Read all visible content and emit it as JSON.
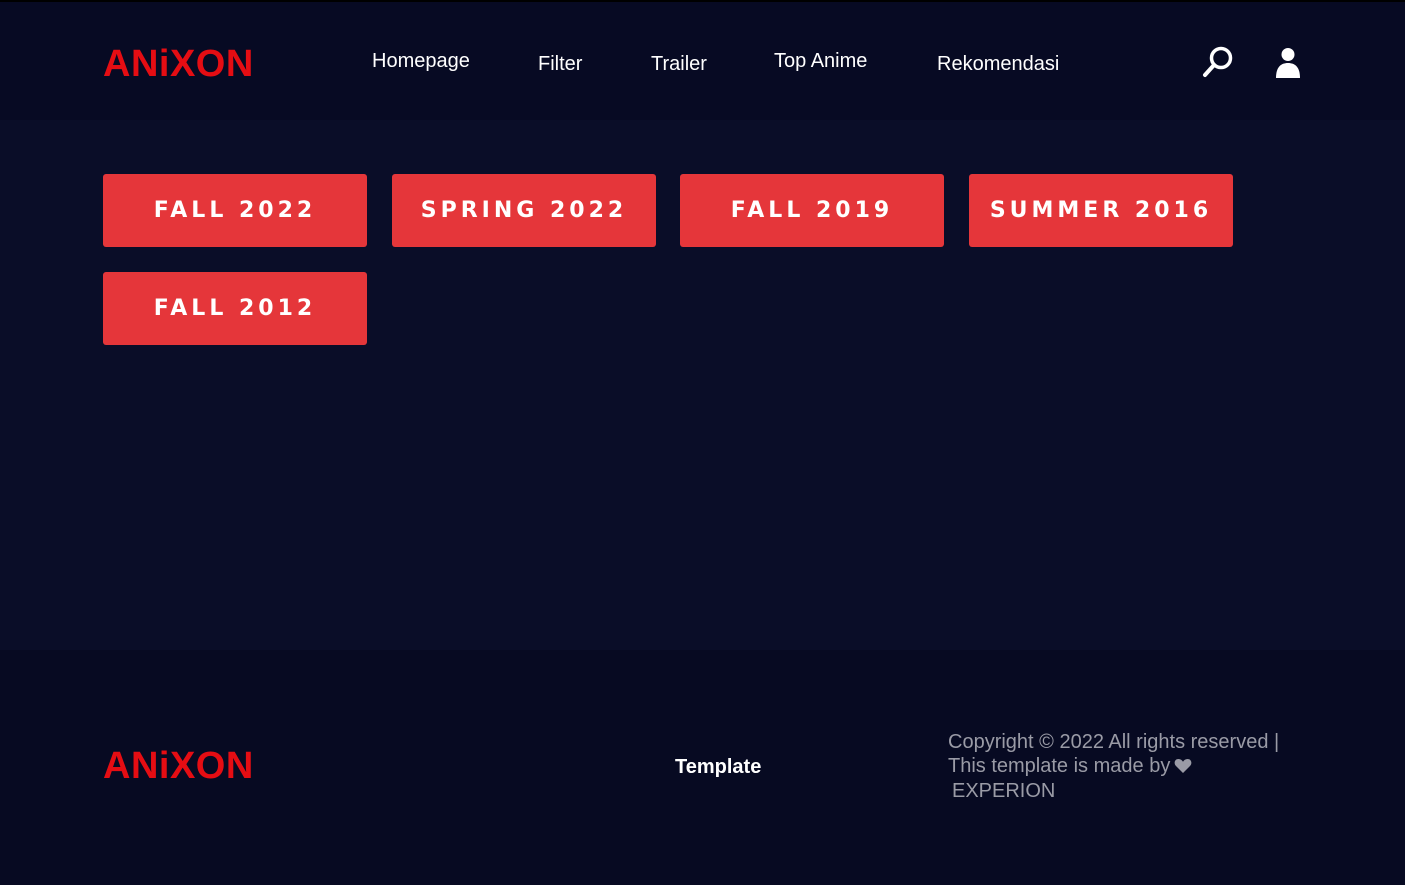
{
  "header": {
    "logo": "ANiXON",
    "nav": [
      {
        "label": "Homepage"
      },
      {
        "label": "Filter"
      },
      {
        "label": "Trailer"
      },
      {
        "label": "Top Anime"
      },
      {
        "label": "Rekomendasi"
      }
    ],
    "icons": {
      "search": "search-icon",
      "user": "user-icon"
    }
  },
  "seasons": [
    {
      "label": "FALL 2022"
    },
    {
      "label": "SPRING 2022"
    },
    {
      "label": "FALL 2019"
    },
    {
      "label": "SUMMER 2016"
    },
    {
      "label": "FALL 2012"
    }
  ],
  "footer": {
    "logo": "ANiXON",
    "link": "Template",
    "copyright_line1": "Copyright © 2022 All rights reserved |",
    "copyright_line2": "This template is made by",
    "brand": "EXPERION"
  },
  "colors": {
    "accent": "#e50d13",
    "button": "#e5363a",
    "background": "#0a0d28",
    "header_bg": "#070a23"
  }
}
